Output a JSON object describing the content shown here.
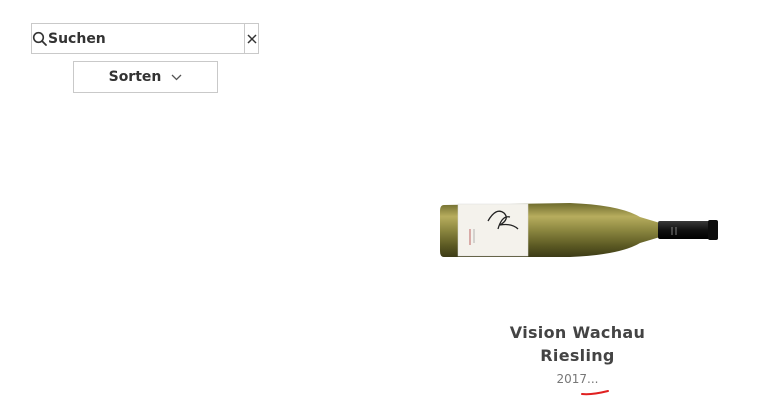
{
  "search": {
    "placeholder": "Suchen",
    "value": "",
    "icon": "search-icon",
    "clear_icon": "close-icon"
  },
  "sort": {
    "label": "Sorten",
    "icon": "chevron-down-icon"
  },
  "product": {
    "title_line1": "Vision Wachau",
    "title_line2": "Riesling",
    "vintage": "2017...",
    "label_script": "Pichler"
  },
  "colors": {
    "border": "#c9c9c9",
    "text": "#333333",
    "bottle_glass": "#8a8a3a",
    "capsule": "#1a1a1a",
    "mark": "#e02020"
  }
}
